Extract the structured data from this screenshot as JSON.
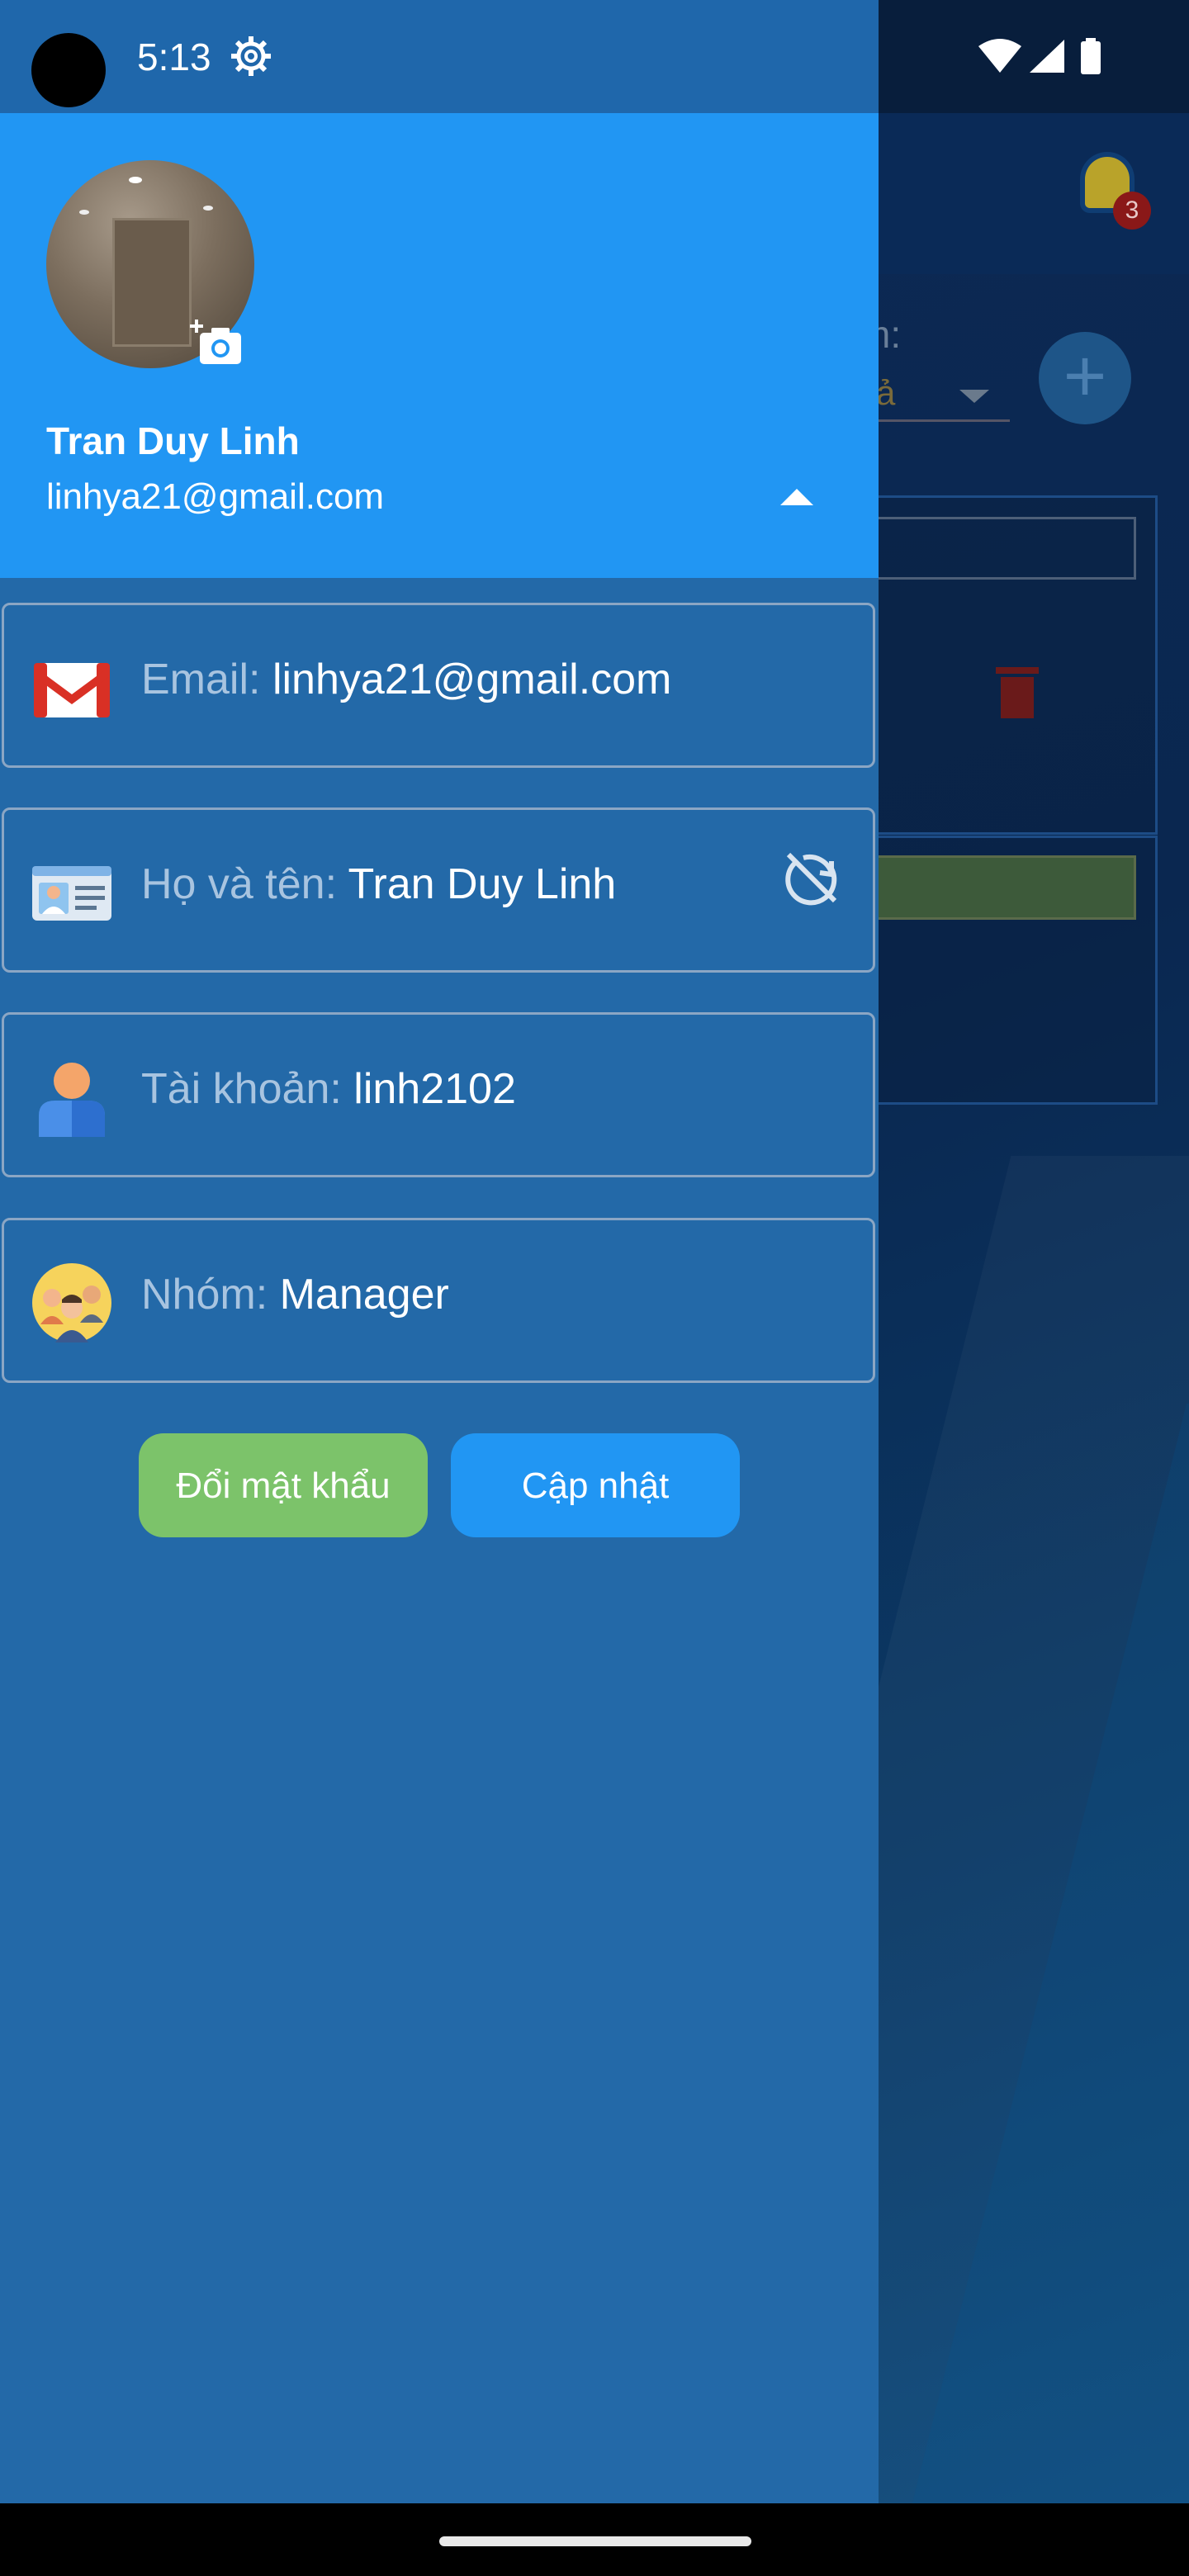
{
  "status_bar": {
    "time": "5:13",
    "icons": [
      "settings-icon",
      "wifi-icon",
      "signal-icon",
      "battery-icon"
    ]
  },
  "background_app": {
    "notification_count": "3",
    "filter_label": "m:",
    "filter_value": "cả"
  },
  "drawer": {
    "header": {
      "name": "Tran Duy Linh",
      "email": "linhya21@gmail.com"
    },
    "fields": {
      "email": {
        "label": "Email:",
        "value": "linhya21@gmail.com",
        "icon": "gmail-icon"
      },
      "full_name": {
        "label": "Họ và tên:",
        "value": "Tran Duy Linh",
        "icon": "id-card-icon"
      },
      "account": {
        "label": "Tài khoản:",
        "value": "linh2102",
        "icon": "user-icon"
      },
      "group": {
        "label": "Nhóm:",
        "value": "Manager",
        "icon": "group-icon"
      }
    },
    "buttons": {
      "change_password": "Đổi mật khẩu",
      "update": "Cập nhật"
    }
  },
  "colors": {
    "header": "#2196f3",
    "drawer": "#2369a8",
    "change_password_button": "#7cc36a",
    "update_button": "#2196f3"
  }
}
